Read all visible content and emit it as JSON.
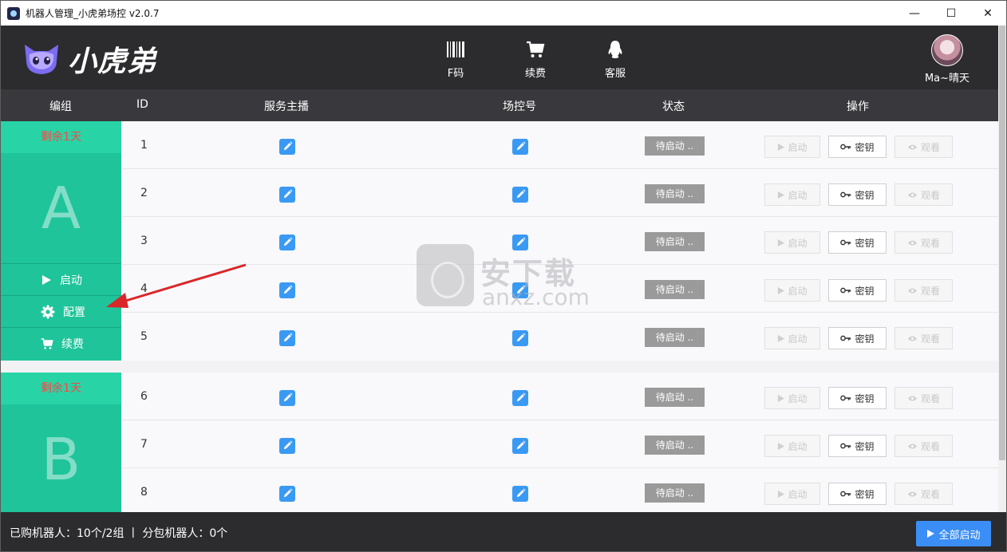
{
  "window": {
    "title": "机器人管理_小虎弟场控 v2.0.7",
    "minimize_glyph": "—",
    "maximize_glyph": "☐",
    "close_glyph": "✕"
  },
  "header": {
    "brand": "小虎弟",
    "nav": [
      {
        "label": "F码",
        "icon": "barcode-icon"
      },
      {
        "label": "续费",
        "icon": "cart-icon"
      },
      {
        "label": "客服",
        "icon": "qq-penguin-icon"
      }
    ],
    "user_name": "Ma~晴天"
  },
  "columns": {
    "group": "编组",
    "id": "ID",
    "anchor": "服务主播",
    "control": "场控号",
    "status": "状态",
    "actions": "操作"
  },
  "groups": [
    {
      "remain": "剩余1天",
      "letter": "A",
      "side_buttons": {
        "start": "启动",
        "config": "配置",
        "renew": "续费"
      },
      "rows": [
        {
          "id": "1",
          "status": "待启动 ..",
          "start": "启动",
          "key": "密钥",
          "watch": "观看"
        },
        {
          "id": "2",
          "status": "待启动 ..",
          "start": "启动",
          "key": "密钥",
          "watch": "观看"
        },
        {
          "id": "3",
          "status": "待启动 ..",
          "start": "启动",
          "key": "密钥",
          "watch": "观看"
        },
        {
          "id": "4",
          "status": "待启动 ..",
          "start": "启动",
          "key": "密钥",
          "watch": "观看"
        },
        {
          "id": "5",
          "status": "待启动 ..",
          "start": "启动",
          "key": "密钥",
          "watch": "观看"
        }
      ]
    },
    {
      "remain": "剩余1天",
      "letter": "B",
      "rows": [
        {
          "id": "6",
          "status": "待启动 ..",
          "start": "启动",
          "key": "密钥",
          "watch": "观看"
        },
        {
          "id": "7",
          "status": "待启动 ..",
          "start": "启动",
          "key": "密钥",
          "watch": "观看"
        },
        {
          "id": "8",
          "status": "待启动 ..",
          "start": "启动",
          "key": "密钥",
          "watch": "观看"
        }
      ]
    }
  ],
  "footer": {
    "stats": "已购机器人：10个/2组  丨  分包机器人：0个",
    "start_all": "全部启动"
  },
  "watermark": {
    "cn": "安下载",
    "en": "anxz.com"
  },
  "colors": {
    "accent_green": "#1fc49a",
    "remain_red": "#ff4444",
    "primary_blue": "#3a8ef5",
    "header_dark": "#2c2c2f"
  }
}
